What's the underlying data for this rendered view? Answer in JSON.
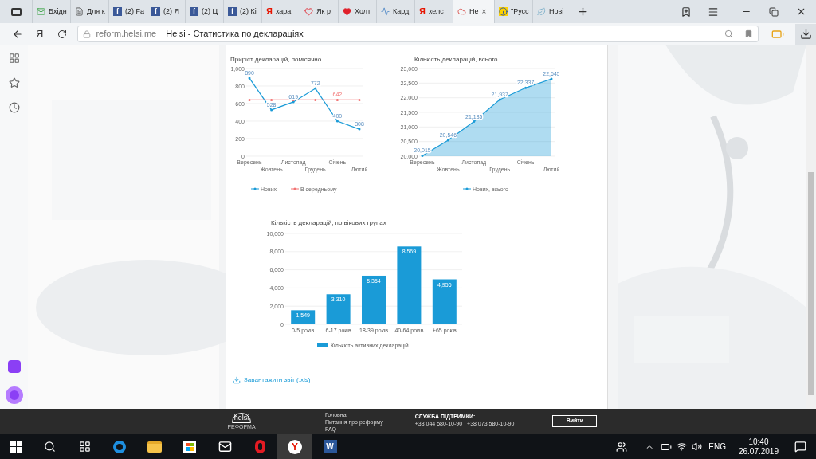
{
  "browser": {
    "tabs": [
      {
        "title": "Вхідн",
        "kind": "mail",
        "selected": false
      },
      {
        "title": "Для к",
        "kind": "doc",
        "selected": false
      },
      {
        "title": "(2) Fa",
        "kind": "facebook",
        "badge": "f",
        "selected": false
      },
      {
        "title": "(2) Я",
        "kind": "facebook",
        "badge": "f",
        "selected": false
      },
      {
        "title": "(2) Ц",
        "kind": "facebook",
        "badge": "f",
        "selected": false
      },
      {
        "title": "(2) Кі",
        "kind": "facebook",
        "badge": "f",
        "selected": false
      },
      {
        "title": "хара",
        "kind": "yandex",
        "badge": "Я",
        "selected": false
      },
      {
        "title": "Як р",
        "kind": "heartline",
        "selected": false
      },
      {
        "title": "Холт",
        "kind": "heart",
        "selected": false
      },
      {
        "title": "Кард",
        "kind": "pulse",
        "selected": false
      },
      {
        "title": "хелс",
        "kind": "yandex",
        "badge": "Я",
        "selected": false
      },
      {
        "title": "Не",
        "kind": "cloud",
        "selected": true,
        "close": "×"
      },
      {
        "title": "\"Русс",
        "kind": "info",
        "selected": false
      },
      {
        "title": "Нові",
        "kind": "leaf",
        "selected": false
      }
    ],
    "yandex_button": "Я",
    "address": {
      "domain": "reform.helsi.me",
      "page_title": "Helsi - Статистика по деклараціях"
    }
  },
  "charts": [
    {
      "chart_data": {
        "type": "line",
        "title": "Приріст декларацій, помісячно",
        "categories": [
          "Вересень",
          "Жовтень",
          "Листопад",
          "Грудень",
          "Січень",
          "Лютий"
        ],
        "series": [
          {
            "name": "Нових",
            "color": "#1a9bd7",
            "values": [
              890,
              528,
              619,
              772,
              400,
              308
            ],
            "value_labels": [
              "890",
              "528",
              "619",
              "772",
              "400",
              "308"
            ]
          },
          {
            "name": "В середньому",
            "color": "#f27272",
            "values": [
              642,
              642,
              642,
              642,
              642,
              642
            ],
            "value_labels": [
              null,
              null,
              null,
              null,
              "642",
              null
            ]
          }
        ],
        "ylim": [
          0,
          1000
        ],
        "yticks": [
          {
            "value": 0,
            "label": "0"
          },
          {
            "value": 200,
            "label": "200"
          },
          {
            "value": 400,
            "label": "400"
          },
          {
            "value": 600,
            "label": "600"
          },
          {
            "value": 800,
            "label": "800"
          },
          {
            "value": 1000,
            "label": "1,000"
          }
        ],
        "grid": true,
        "legend": "bottom"
      }
    },
    {
      "chart_data": {
        "type": "area",
        "title": "Кількість декларацій, всього",
        "categories": [
          "Вересень",
          "Жовтень",
          "Листопад",
          "Грудень",
          "Січень",
          "Лютий"
        ],
        "series": [
          {
            "name": "Нових, всього",
            "color": "#1a9bd7",
            "values": [
              20015,
              20546,
              21185,
              21937,
              22337,
              22645
            ],
            "value_labels": [
              "20,015",
              "20,546",
              "21,185",
              "21,937",
              "22,337",
              "22,645"
            ]
          }
        ],
        "ylim": [
          20000,
          23000
        ],
        "yticks": [
          {
            "value": 20000,
            "label": "20,000"
          },
          {
            "value": 20500,
            "label": "20,500"
          },
          {
            "value": 21000,
            "label": "21,000"
          },
          {
            "value": 21500,
            "label": "21,500"
          },
          {
            "value": 22000,
            "label": "22,000"
          },
          {
            "value": 22500,
            "label": "22,500"
          },
          {
            "value": 23000,
            "label": "23,000"
          }
        ],
        "grid": true,
        "legend": "bottom"
      }
    },
    {
      "chart_data": {
        "type": "bar",
        "title": "Кількість декларацій, по вікових групах",
        "categories": [
          "0-5 років",
          "6-17 років",
          "18-39 років",
          "40-64 років",
          "+65 років"
        ],
        "series": [
          {
            "name": "Кількість активних декларацій",
            "color": "#1a9bd7",
            "values": [
              1549,
              3310,
              5354,
              8569,
              4956
            ],
            "value_labels": [
              "1,549",
              "3,310",
              "5,354",
              "8,569",
              "4,956"
            ]
          }
        ],
        "ylim": [
          0,
          10000
        ],
        "yticks": [
          {
            "value": 0,
            "label": "0"
          },
          {
            "value": 2000,
            "label": "2,000"
          },
          {
            "value": 4000,
            "label": "4,000"
          },
          {
            "value": 6000,
            "label": "6,000"
          },
          {
            "value": 8000,
            "label": "8,000"
          },
          {
            "value": 10000,
            "label": "10,000"
          }
        ],
        "grid": true,
        "legend": "bottom"
      }
    }
  ],
  "download_link": "Завантажити звіт (.xls)",
  "footer": {
    "logo": "helsi",
    "logo_caption": "РЕФОРМА",
    "links": [
      "Головна",
      "Питання про реформу",
      "FAQ"
    ],
    "support_title": "СЛУЖБА ПІДТРИМКИ:",
    "phones": [
      "+38 044 580-10-90",
      "+38 073 580-10-90"
    ],
    "login_button": "Вийти"
  },
  "taskbar": {
    "apps": [
      {
        "kind": "search"
      },
      {
        "kind": "taskview"
      },
      {
        "kind": "edge"
      },
      {
        "kind": "folder"
      },
      {
        "kind": "store"
      },
      {
        "kind": "mail"
      },
      {
        "kind": "opera"
      },
      {
        "kind": "yandex",
        "badge": "Y",
        "selected": true
      },
      {
        "kind": "word",
        "badge": "W"
      }
    ],
    "language": "ENG",
    "time": "10:40",
    "date": "26.07.2019"
  }
}
